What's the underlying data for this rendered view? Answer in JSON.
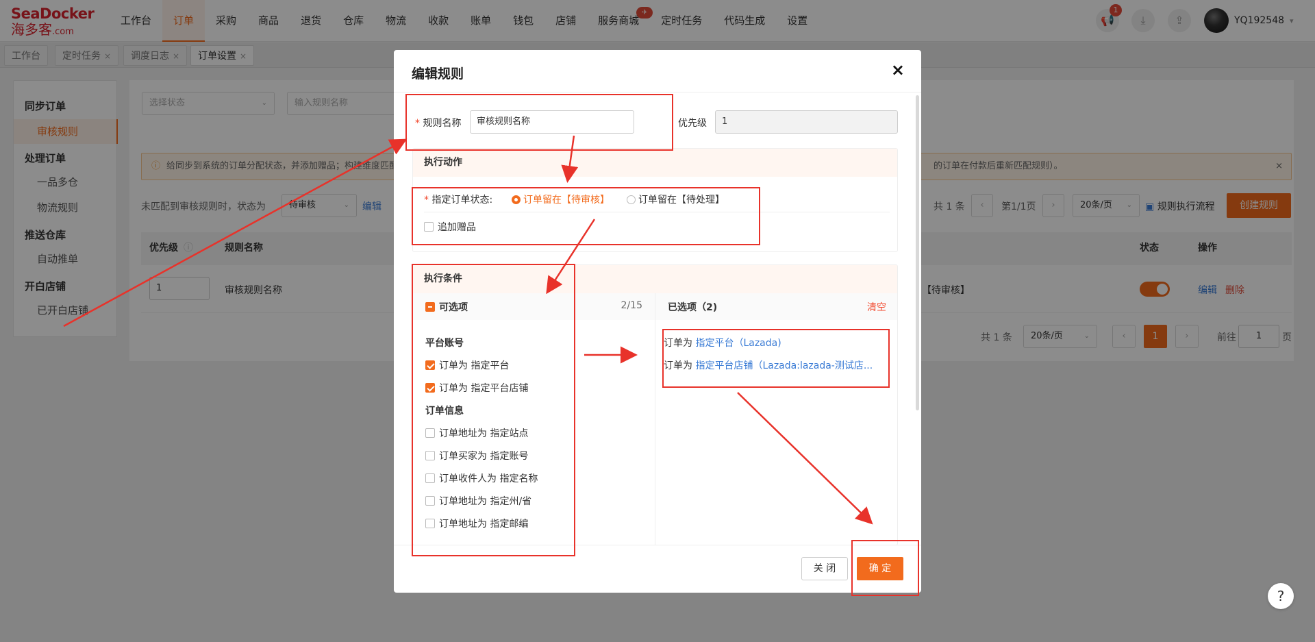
{
  "logo": {
    "en": "SeaDocker",
    "cn": "海多客",
    "suffix": ".com"
  },
  "nav": [
    {
      "label": "工作台"
    },
    {
      "label": "订单",
      "active": true
    },
    {
      "label": "采购"
    },
    {
      "label": "商品"
    },
    {
      "label": "退货"
    },
    {
      "label": "仓库"
    },
    {
      "label": "物流"
    },
    {
      "label": "收款"
    },
    {
      "label": "账单"
    },
    {
      "label": "钱包"
    },
    {
      "label": "店铺"
    },
    {
      "label": "服务商城",
      "badge": "✈"
    },
    {
      "label": "定时任务"
    },
    {
      "label": "代码生成"
    },
    {
      "label": "设置"
    }
  ],
  "header": {
    "notif_count": "1",
    "username": "YQ192548",
    "icons": [
      "megaphone-icon",
      "download-icon",
      "share-icon"
    ]
  },
  "tabs": [
    {
      "label": "工作台"
    },
    {
      "label": "定时任务",
      "close": "×"
    },
    {
      "label": "调度日志",
      "close": "×"
    },
    {
      "label": "订单设置",
      "close": "×",
      "active": true
    }
  ],
  "sidebar": {
    "groups": [
      {
        "title": "同步订单",
        "items": [
          "审核规则"
        ]
      },
      {
        "title": "处理订单",
        "items": [
          "一品多仓",
          "物流规则"
        ]
      },
      {
        "title": "推送仓库",
        "items": [
          "自动推单"
        ]
      },
      {
        "title": "开白店铺",
        "items": [
          "已开白店铺"
        ]
      }
    ]
  },
  "filters": {
    "status_placeholder": "选择状态",
    "name_placeholder": "输入规则名称"
  },
  "alert": {
    "text": "给同步到系统的订单分配状态，并添加赠品；构建维度匹配",
    "tail": "的订单在付款后重新匹配规则）。",
    "close": "×"
  },
  "unmatched": {
    "text": "未匹配到审核规则时，状态为",
    "value": "待审核",
    "edit": "编辑"
  },
  "pager_top": {
    "total": "共 1 条",
    "page": "第1/1页",
    "size": "20条/页",
    "flow": "规则执行流程",
    "create": "创建规则"
  },
  "table": {
    "headers": {
      "priority": "优先级",
      "name": "规则名称",
      "status": "状态",
      "ops": "操作"
    },
    "row": {
      "priority": "1",
      "name": "审核规则名称",
      "result": "【待审核】",
      "edit": "编辑",
      "delete": "删除"
    }
  },
  "pager_bottom": {
    "total": "共 1 条",
    "size": "20条/页",
    "page": "1",
    "goto": "前往",
    "goto_value": "1",
    "unit": "页"
  },
  "modal": {
    "title": "编辑规则",
    "close": "×",
    "rule_name_label": "规则名称",
    "rule_name_value": "审核规则名称",
    "priority_label": "优先级",
    "priority_value": "1",
    "action_title": "执行动作",
    "status_label": "指定订单状态:",
    "option_pending_review": "订单留在【待审核】",
    "option_pending_process": "订单留在【待处理】",
    "add_gift": "追加赠品",
    "cond_title": "执行条件",
    "available_title": "可选项",
    "available_count": "2/15",
    "selected_title": "已选项（2)",
    "clear": "清空",
    "groups": [
      {
        "title": "平台账号",
        "items": [
          {
            "label": "订单为 指定平台",
            "checked": true
          },
          {
            "label": "订单为 指定平台店铺",
            "checked": true
          }
        ]
      },
      {
        "title": "订单信息",
        "items": [
          {
            "label": "订单地址为 指定站点",
            "checked": false
          },
          {
            "label": "订单买家为 指定账号",
            "checked": false
          },
          {
            "label": "订单收件人为 指定名称",
            "checked": false
          },
          {
            "label": "订单地址为 指定州/省",
            "checked": false
          },
          {
            "label": "订单地址为 指定邮编",
            "checked": false
          }
        ]
      }
    ],
    "selected": [
      {
        "prefix": "订单为 ",
        "link": "指定平台（Lazada)"
      },
      {
        "prefix": "订单为 ",
        "link": "指定平台店铺（Lazada:lazada-测试店..."
      }
    ],
    "btn_close": "关 闭",
    "btn_ok": "确 定"
  },
  "help": "?"
}
